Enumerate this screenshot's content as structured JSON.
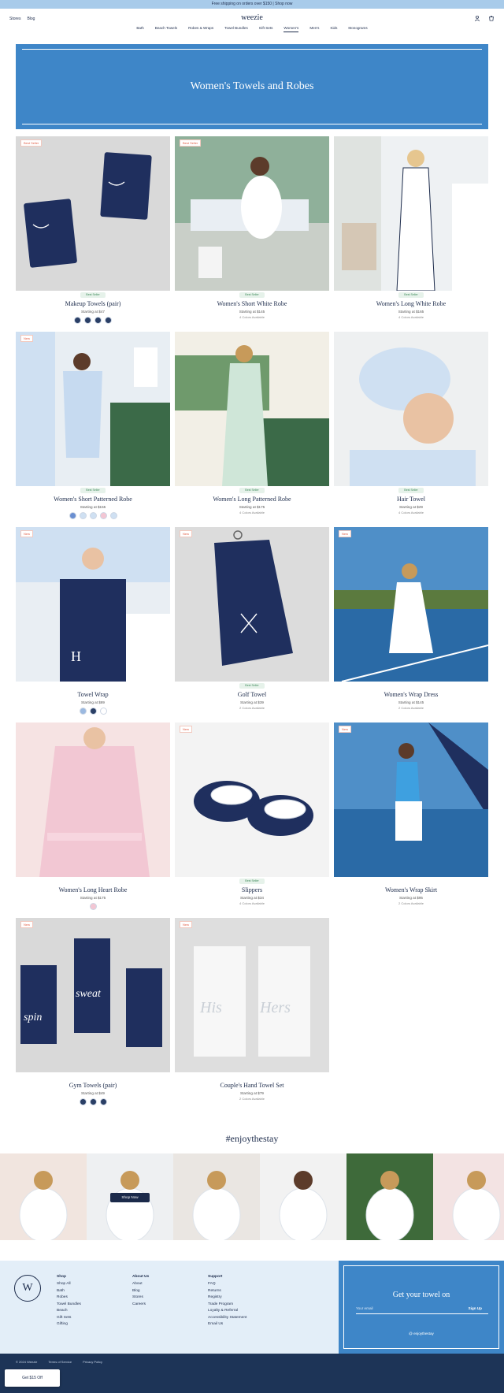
{
  "announcement": "Free shipping on orders over $150 | Shop now",
  "header": {
    "left_links": [
      "Stores",
      "Blog"
    ],
    "logo": "weezie",
    "nav": [
      "Bath",
      "Beach Towels",
      "Robes & Wraps",
      "Towel Bundles",
      "Gift Sets",
      "Women's",
      "Men's",
      "Kids",
      "Monograms"
    ],
    "active_nav_index": 5
  },
  "banner": {
    "title": "Women's Towels and Robes"
  },
  "products": [
    {
      "name": "Makeup Towels (pair)",
      "price": "Starting at $47",
      "tag": "Best Seller",
      "badge": "Best Seller",
      "sub": "",
      "swatches": [
        "#2a3f66",
        "#2a3f66",
        "#2a3f66",
        "#2a3f66"
      ]
    },
    {
      "name": "Women's Short White Robe",
      "price": "Starting at $145",
      "tag": "Best Seller",
      "badge": "Best Seller",
      "sub": "4 Colors Available",
      "swatches": []
    },
    {
      "name": "Women's Long White Robe",
      "price": "Starting at $165",
      "tag": "Best Seller",
      "badge": "",
      "sub": "4 Colors Available",
      "swatches": []
    },
    {
      "name": "Women's Short Patterned Robe",
      "price": "Starting at $155",
      "tag": "Best Seller",
      "badge": "New",
      "sub": "",
      "swatches": [
        "#6a8fd1",
        "#cfe0f2",
        "#cfe0f2",
        "#f3c6d3",
        "#cfe0f2"
      ]
    },
    {
      "name": "Women's Long Patterned Robe",
      "price": "Starting at $175",
      "tag": "Best Seller",
      "badge": "",
      "sub": "4 Colors Available",
      "swatches": []
    },
    {
      "name": "Hair Towel",
      "price": "Starting at $29",
      "tag": "Best Seller",
      "badge": "",
      "sub": "4 Colors Available",
      "swatches": []
    },
    {
      "name": "Towel Wrap",
      "price": "Starting at $89",
      "tag": "",
      "badge": "New",
      "sub": "",
      "swatches": [
        "#9bb9e0",
        "#2a3f66",
        "#ffffff"
      ]
    },
    {
      "name": "Golf Towel",
      "price": "Starting at $39",
      "tag": "Best Seller",
      "badge": "New",
      "sub": "2 Colors Available",
      "swatches": []
    },
    {
      "name": "Women's Wrap Dress",
      "price": "Starting at $145",
      "tag": "",
      "badge": "New",
      "sub": "2 Colors Available",
      "swatches": []
    },
    {
      "name": "Women's Long Heart Robe",
      "price": "Starting at $175",
      "tag": "",
      "badge": "",
      "sub": "",
      "swatches": [
        "#f3c6d3"
      ]
    },
    {
      "name": "Slippers",
      "price": "Starting at $34",
      "tag": "Best Seller",
      "badge": "New",
      "sub": "4 Colors Available",
      "swatches": []
    },
    {
      "name": "Women's Wrap Skirt",
      "price": "Starting at $95",
      "tag": "",
      "badge": "New",
      "sub": "2 Colors Available",
      "swatches": []
    },
    {
      "name": "Gym Towels (pair)",
      "price": "Starting at $49",
      "tag": "",
      "badge": "New",
      "sub": "",
      "swatches": [
        "#2a3f66",
        "#2a3f66",
        "#2a3f66"
      ]
    },
    {
      "name": "Couple's Hand Towel Set",
      "price": "Starting at $79",
      "tag": "",
      "badge": "New",
      "sub": "2 Colors Available",
      "swatches": []
    }
  ],
  "enjoy": {
    "title": "#enjoythestay",
    "shop_label": "Shop Now"
  },
  "footer": {
    "emblem": "W",
    "cols": [
      {
        "heading": "Shop",
        "items": [
          "Shop All",
          "Bath",
          "Robes",
          "Towel Bundles",
          "Beach",
          "Gift Sets",
          "Gifting"
        ]
      },
      {
        "heading": "About Us",
        "items": [
          "About",
          "Blog",
          "Stores",
          "Careers"
        ]
      },
      {
        "heading": "Support",
        "items": [
          "FAQ",
          "Returns",
          "Registry",
          "Trade Program",
          "Loyalty & Referral",
          "Accessibility Statement",
          "Email Us"
        ]
      }
    ],
    "newsletter_heading": "Get your towel on",
    "email_placeholder": "Your email",
    "signup_label": "Sign Up",
    "instagram": "@ enjoythestay",
    "legal": [
      "© 2024 Weezie",
      "Terms of Service",
      "Privacy Policy"
    ],
    "gift_button": "Get $15 Off"
  },
  "colors": {
    "brand_blue": "#3e86c8",
    "navy": "#1b2a4a",
    "footer_bg": "#e3eef8"
  }
}
